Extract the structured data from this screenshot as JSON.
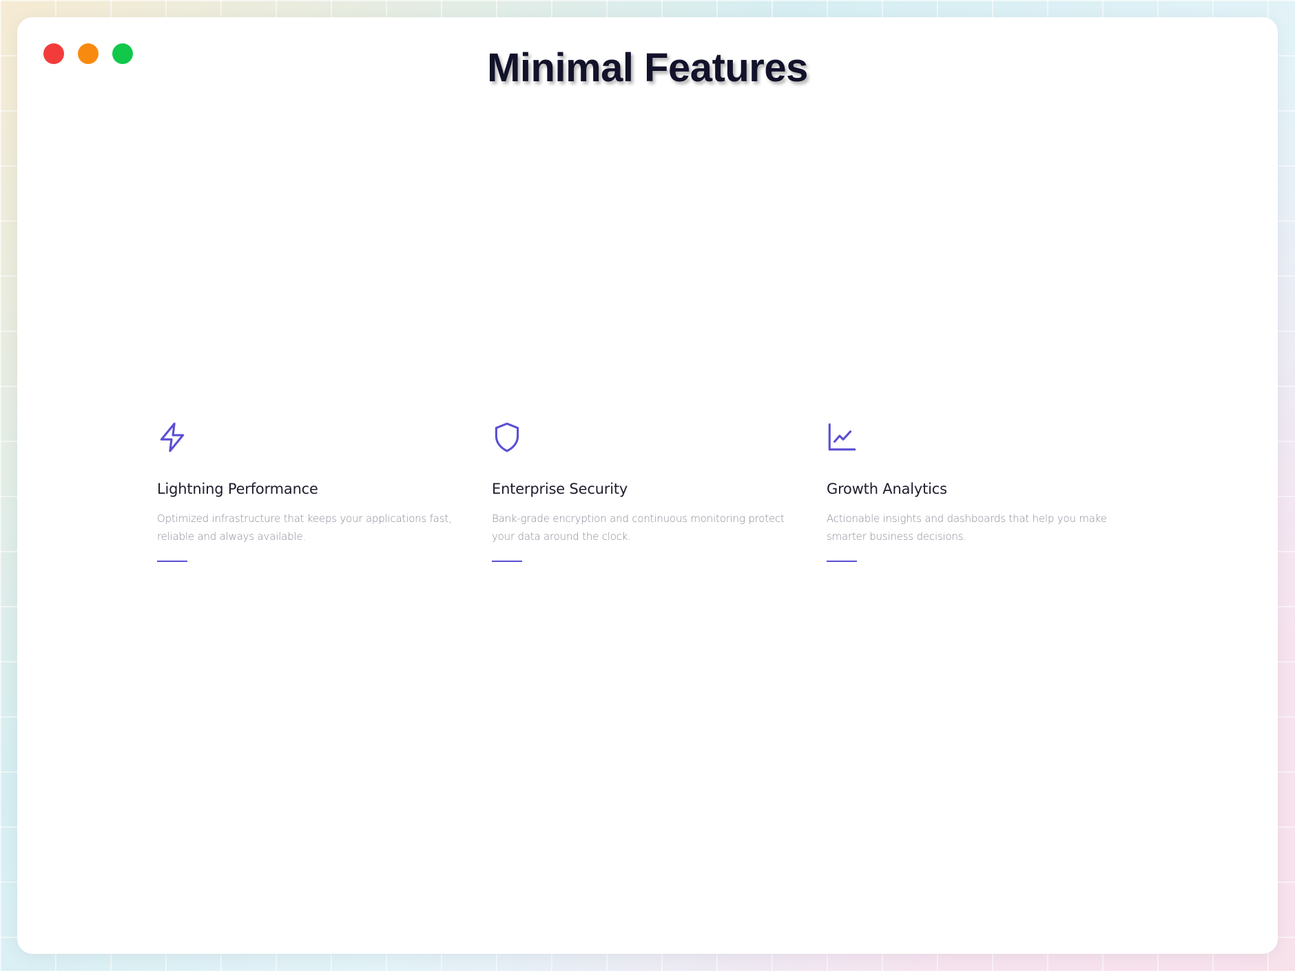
{
  "page": {
    "title": "Minimal Features"
  },
  "colors": {
    "accent": "#5b4fd4",
    "close": "#f23c3c",
    "minimize": "#f98a10",
    "maximize": "#12c84a"
  },
  "features": [
    {
      "icon": "lightning-icon",
      "title": "Lightning Performance",
      "description": "Optimized infrastructure that keeps your applications fast, reliable and always available."
    },
    {
      "icon": "shield-icon",
      "title": "Enterprise Security",
      "description": "Bank-grade encryption and continuous monitoring protect your data around the clock."
    },
    {
      "icon": "chart-line-icon",
      "title": "Growth Analytics",
      "description": "Actionable insights and dashboards that help you make smarter business decisions."
    }
  ]
}
